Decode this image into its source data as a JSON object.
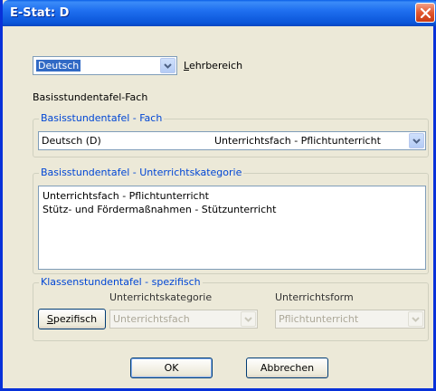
{
  "window": {
    "title": "E-Stat: D"
  },
  "subject_select": {
    "value": "Deutsch"
  },
  "lehrbereich_label": {
    "prefix": "L",
    "rest": "ehrbereich"
  },
  "basis_fach_label": "Basisstundentafel-Fach",
  "group_fach": {
    "legend": "Basisstundentafel - Fach",
    "combo_left": "Deutsch (D)",
    "combo_right": "Unterrichtsfach  -  Pflichtunterricht"
  },
  "group_kategorie": {
    "legend": "Basisstundentafel - Unterrichtskategorie",
    "items": [
      "Unterrichtsfach  -  Pflichtunterricht",
      "Stütz- und Fördermaßnahmen  -  Stützunterricht"
    ]
  },
  "group_klassen": {
    "legend": "Klassenstundentafel - spezifisch",
    "col_kategorie": "Unterrichtskategorie",
    "col_form": "Unterrichtsform",
    "spezifisch_button": {
      "prefix": "S",
      "rest": "pezifisch"
    },
    "kategorie_value": "Unterrichtsfach",
    "form_value": "Pflichtunterricht"
  },
  "buttons": {
    "ok": "OK",
    "cancel": "Abbrechen"
  },
  "colors": {
    "titlebar": "#0a5fe6",
    "group_legend": "#0046d5",
    "selection": "#316ac5"
  }
}
